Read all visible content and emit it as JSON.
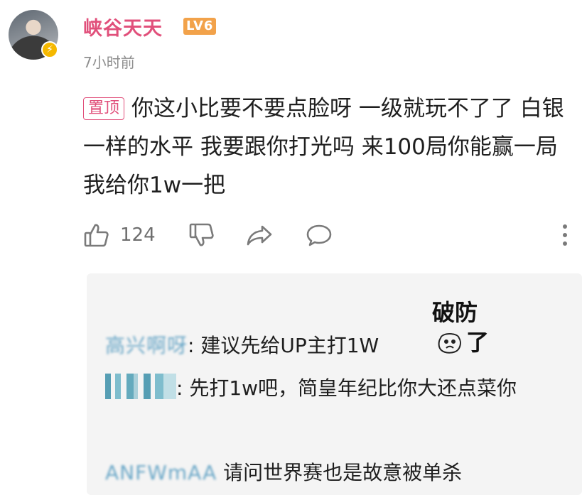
{
  "comment_author": {
    "name": "峡谷天天",
    "level": "LV6",
    "time": "7小时前"
  },
  "comment": {
    "pin_tag": "置顶",
    "text": "你这小比要不要点脸呀 一级就玩不了了 白银一样的水平 我要跟你打光吗 来100局你能赢一局我给你1w一把"
  },
  "actions": {
    "like_count": "124",
    "icons": [
      "thumbs-up-icon",
      "thumbs-down-icon",
      "share-icon",
      "comment-icon",
      "more-icon"
    ]
  },
  "replies": [
    {
      "name": "高兴啊呀",
      "text": ": 建议先给UP主打1W"
    },
    {
      "name": "",
      "text": ": 先打1w吧，简皇年纪比你大还点菜你"
    },
    {
      "name": "ANFWmAA",
      "text": " 请问世界赛也是故意被单杀"
    }
  ],
  "sticker": {
    "line1": "破防",
    "line2": "了"
  },
  "colors": {
    "username": "#e1507b",
    "level_badge": "#f2a24a",
    "reply_name": "#6aa7c7",
    "reply_bg": "#f4f4f4"
  }
}
